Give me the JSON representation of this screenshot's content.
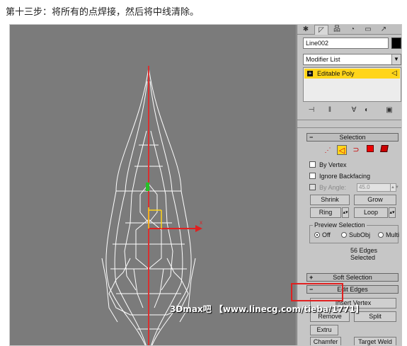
{
  "caption": "第十三步：将所有的点焊接，然后将中线清除。",
  "panel": {
    "tabs": [
      "✱",
      "◸",
      "品",
      "◔",
      "▭",
      "↗"
    ],
    "object_name": "Line002",
    "object_color": "#000000",
    "modifier_list": "Modifier List",
    "stack_item": "Editable Poly",
    "stack_tools": [
      "⊣",
      "‖",
      "∀",
      "◐",
      "▣"
    ],
    "selection": {
      "title": "Selection",
      "subobj_icons": [
        "vertex-icon",
        "edge-icon",
        "border-icon",
        "polygon-icon",
        "element-icon"
      ],
      "by_vertex": "By Vertex",
      "ignore_backfacing": "Ignore Backfacing",
      "by_angle": "By Angle:",
      "angle_value": "45.0",
      "shrink": "Shrink",
      "grow": "Grow",
      "ring": "Ring",
      "loop": "Loop",
      "preview_title": "Preview Selection",
      "preview_off": "Off",
      "preview_subobj": "SubObj",
      "preview_multi": "Multi",
      "status": "56 Edges Selected"
    },
    "soft_selection": {
      "title": "Soft Selection"
    },
    "edit_edges": {
      "title": "Edit Edges",
      "insert_vertex": "Insert Vertex",
      "remove": "Remove",
      "split": "Split",
      "extrude": "Extru",
      "chamfer": "Chamfer",
      "target_weld": "Target Weld"
    }
  },
  "watermark": "3Dmax吧 【www.linecg.com/tieba/1771】",
  "colors": {
    "accent_yellow": "#ffd51a",
    "highlight_red": "#e02020",
    "viewport_bg": "#7b7b7b",
    "wire": "#ffffff",
    "center_line": "#d83030"
  }
}
